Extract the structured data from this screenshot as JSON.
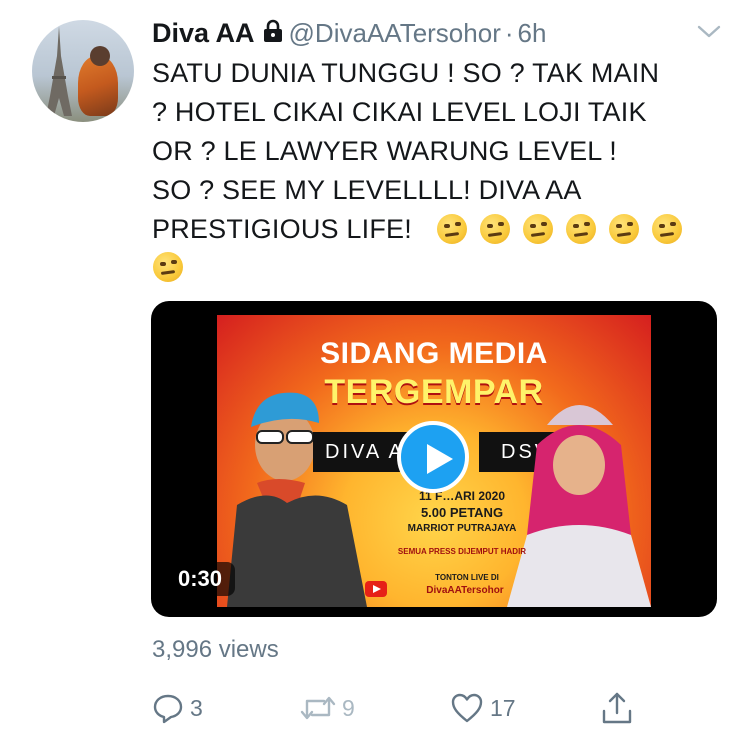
{
  "tweet": {
    "author_name": "Diva AA",
    "handle": "@DivaAATersohor",
    "separator": "·",
    "time": "6h",
    "protected_icon": "lock-icon",
    "text": "SATU DUNIA TUNGGU ! SO ? TAK MAIN\n? HOTEL CIKAI CIKAI LEVEL LOJI TAIK\nOR ? LE LAWYER WARUNG LEVEL !\nSO ? SEE MY LEVELLLL! DIVA AA\nPRESTIGIOUS LIFE!",
    "emoji_count": 7,
    "emoji_name": "face-with-raised-eyebrow"
  },
  "video": {
    "duration": "0:30",
    "poster": {
      "title_line1": "SIDANG MEDIA",
      "title_line2": "TERGEMPAR",
      "left_name": "DIVA A",
      "right_name": "DSV",
      "date": "11 F…ARI 2020",
      "time": "5.00 PETANG",
      "venue": "MARRIOT PUTRAJAYA",
      "note": "SEMUA PRESS DIJEMPUT HADIR",
      "watch_label": "TONTON LIVE DI",
      "channel": "DivaAATersohor"
    }
  },
  "stats": {
    "views": "3,996 views"
  },
  "actions": {
    "reply_count": "3",
    "retweet_count": "9",
    "like_count": "17"
  },
  "colors": {
    "text": "#14171a",
    "secondary": "#657786",
    "accent": "#1da1f2",
    "retweet_disabled": "#aab8c2"
  }
}
